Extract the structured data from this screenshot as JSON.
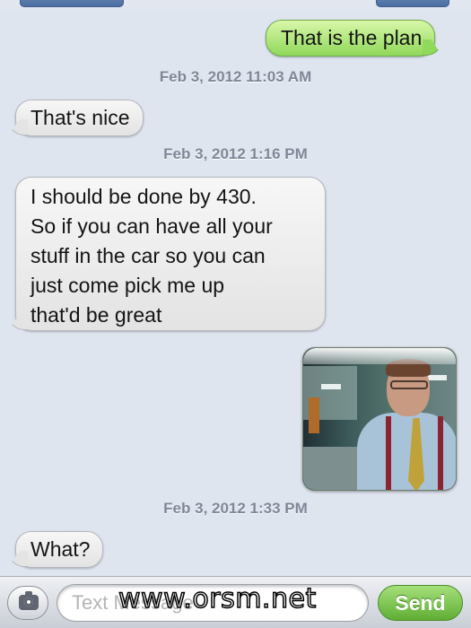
{
  "messages": [
    {
      "type": "outgoing",
      "text": "That is the plan"
    },
    {
      "type": "timestamp",
      "text": "Feb 3, 2012 11:03 AM"
    },
    {
      "type": "incoming",
      "text": "That's nice"
    },
    {
      "type": "timestamp",
      "text": "Feb 3, 2012 1:16 PM"
    },
    {
      "type": "incoming",
      "lines": [
        "I should be done by 430.",
        "So if you can have all your",
        "stuff in the car so you can",
        "just come pick me up",
        "that'd be great"
      ]
    },
    {
      "type": "outgoing-image",
      "description": "photo"
    },
    {
      "type": "timestamp",
      "text": "Feb 3, 2012 1:33 PM"
    },
    {
      "type": "incoming",
      "text": "What?"
    }
  ],
  "input_bar": {
    "placeholder": "Text Message",
    "send_label": "Send"
  },
  "watermark": "www.orsm.net",
  "colors": {
    "background": "#dfe5ef",
    "outgoing_bubble": "#8fd85a",
    "incoming_bubble": "#e3e3e3",
    "send_button": "#5fae34",
    "timestamp": "#7f8797"
  }
}
